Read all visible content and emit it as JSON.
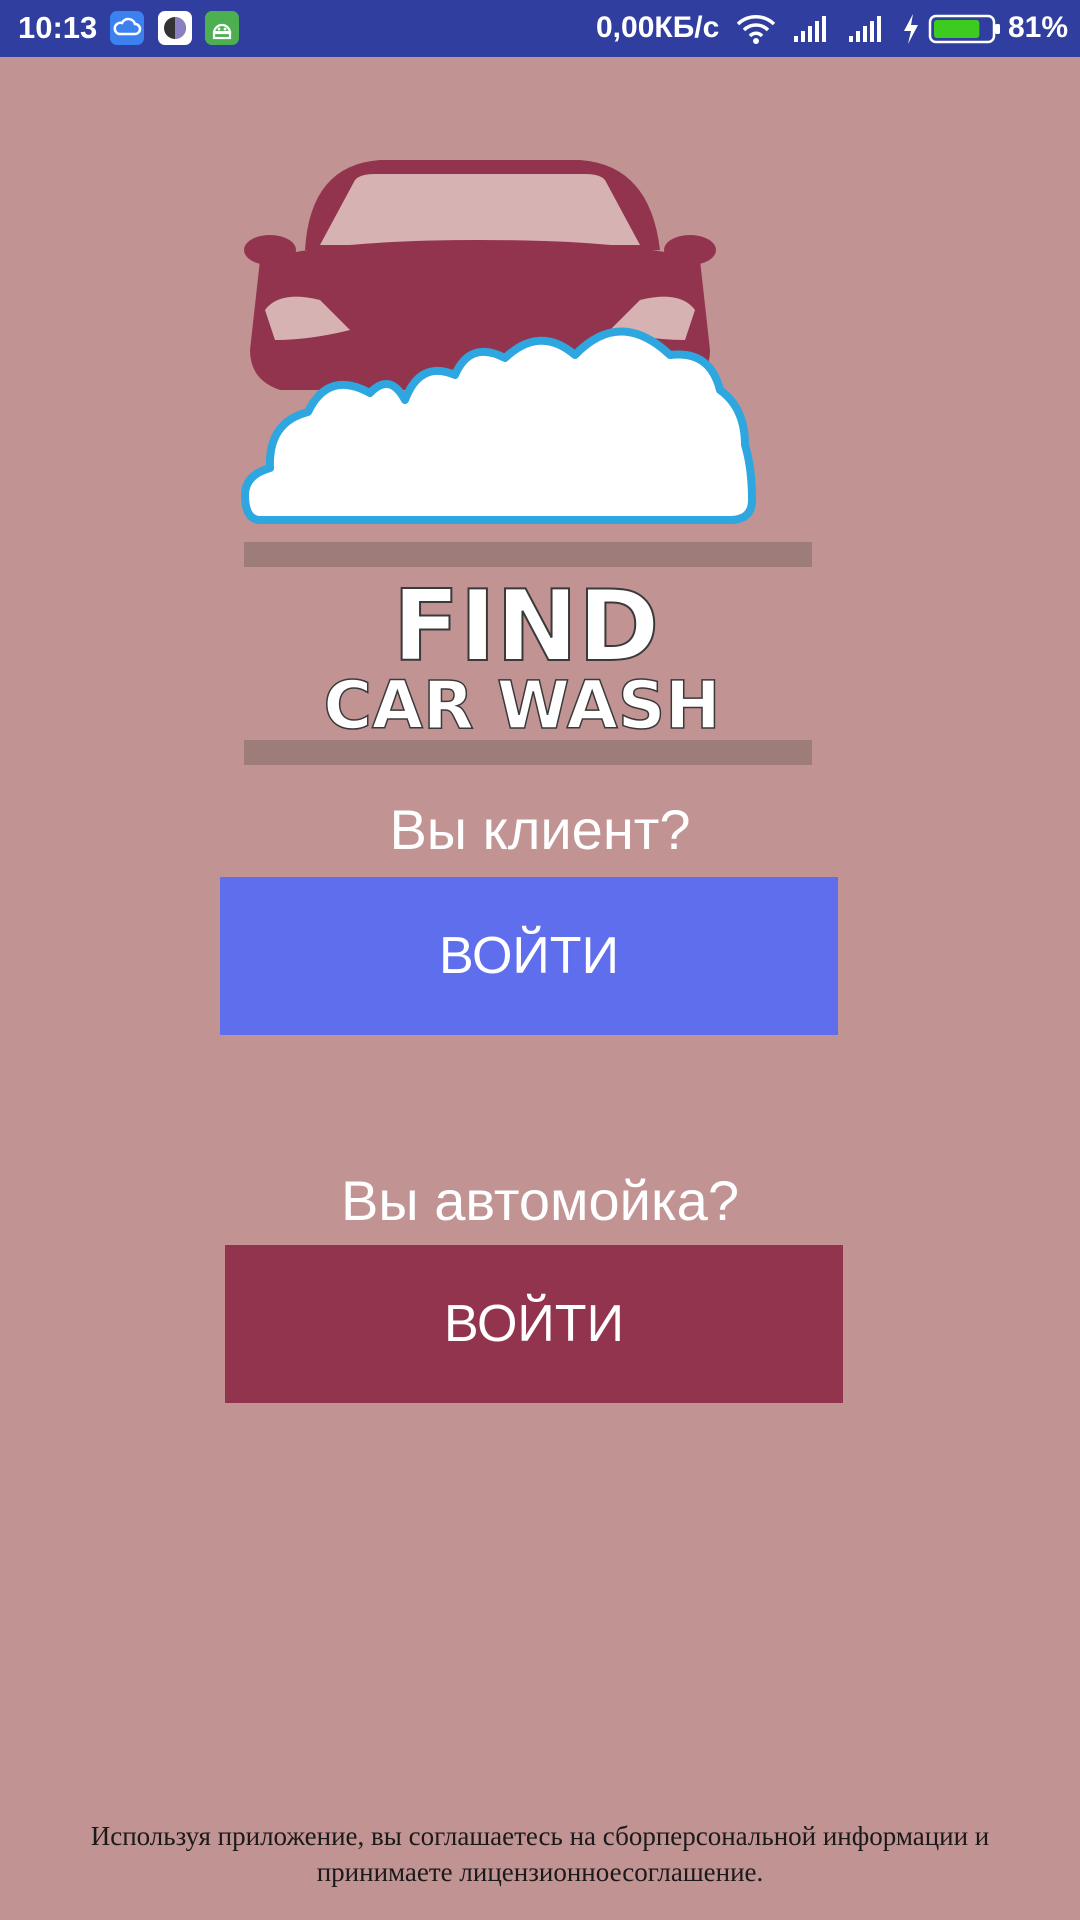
{
  "status_bar": {
    "time": "10:13",
    "network_speed": "0,00КБ/с",
    "battery_percent": "81%",
    "battery_level": 0.81,
    "icons": [
      "cloud-notification-icon",
      "app-notification-icon",
      "android-notification-icon",
      "wifi-icon",
      "signal-icon",
      "signal-icon",
      "charging-icon",
      "battery-icon"
    ]
  },
  "logo": {
    "line1": "FIND",
    "line2": "CAR WASH",
    "colors": {
      "car": "#93344f",
      "cloud_outline": "#2ea7e0",
      "band": "#9e7c79"
    }
  },
  "client": {
    "question": "Вы клиент?",
    "button_label": "ВОЙТИ",
    "button_color": "#5e6eed"
  },
  "carwash": {
    "question": "Вы автомойка?",
    "button_label": "ВОЙТИ",
    "button_color": "#93344f"
  },
  "footer": {
    "text": "Используя приложение, вы соглашаетесь на сборперсональной информации и принимаете лицензионноесоглашение."
  },
  "colors": {
    "background": "#c29393",
    "status_bar": "#303f9f"
  }
}
